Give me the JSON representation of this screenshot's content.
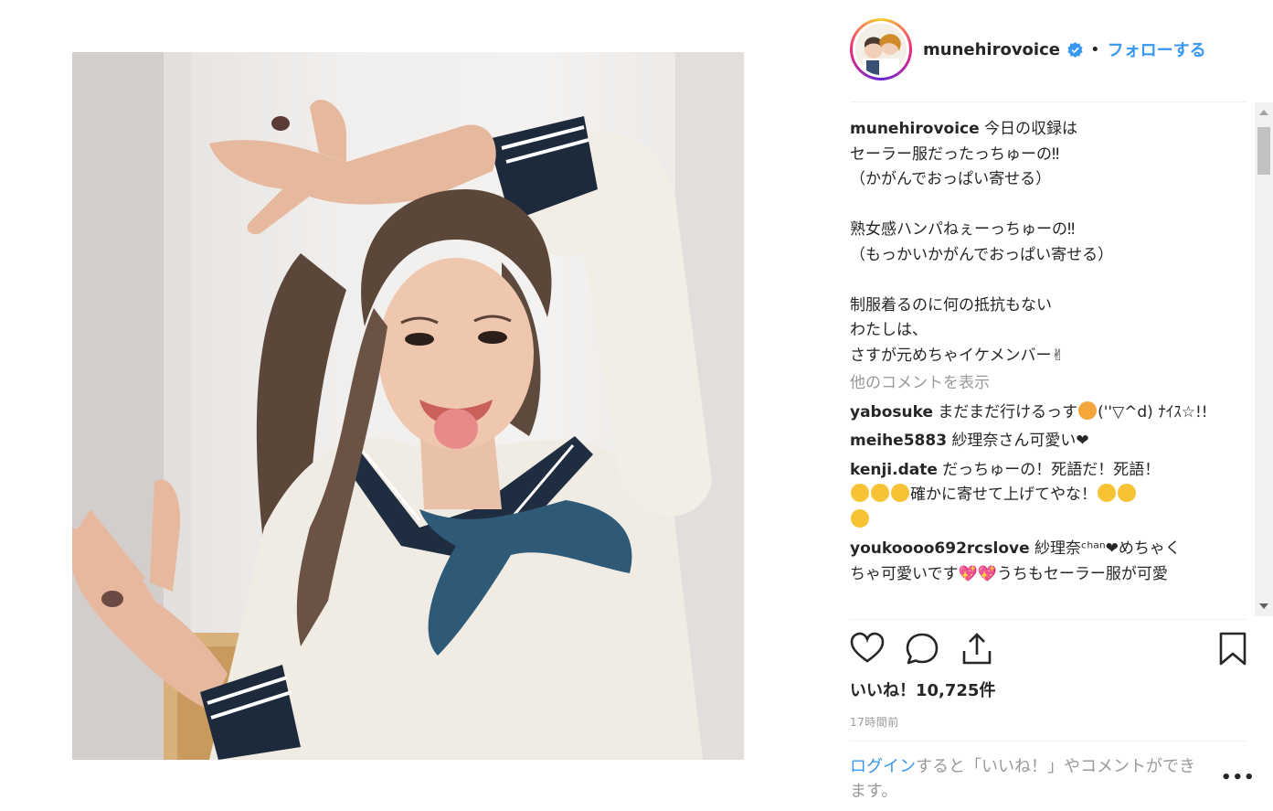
{
  "post": {
    "username": "munehirovoice",
    "dot": "•",
    "follow_label": "フォローする"
  },
  "caption": {
    "username": "munehirovoice",
    "lines": [
      "今日の収録は",
      "セーラー服だったっちゅーの‼",
      "（かがんでおっぱい寄せる）",
      "",
      "熟女感ハンパねぇーっちゅーの‼",
      "（もっかいかがんでおっぱい寄せる）",
      "",
      "制服着るのに何の抵抗もない",
      "わたしは、",
      "さすが元めちゃイケメンバー✌"
    ]
  },
  "more_comments": "他のコメントを表示",
  "comments": [
    {
      "user": "yabosuke",
      "text_a": "まだまだ行けるっす",
      "text_b": "(''▽^d) ﾅｲｽ☆!!"
    },
    {
      "user": "meihe5883",
      "text": "紗理奈さん可愛い❤"
    },
    {
      "user": "kenji.date",
      "text_a": "だっちゅーの！死語だ！死語！",
      "text_b": "確かに寄せて上げてやな！"
    },
    {
      "user": "youkoooo692rcslove",
      "text_a": "紗理奈ᶜʰᵃⁿ❤めちゃく",
      "text_b": "ちゃ可愛いです💖💖うちもセーラー服が可愛"
    }
  ],
  "likes": "いいね！10,725件",
  "time": "17時間前",
  "login": {
    "link": "ログイン",
    "text": "すると「いいね！」やコメントができます。"
  },
  "ellipsis": "•••",
  "icons": [
    "heart-icon",
    "comment-icon",
    "share-icon",
    "bookmark-icon",
    "verified-badge-icon"
  ],
  "colors": {
    "accent": "#3897f0",
    "text": "#262626",
    "muted": "#999999"
  }
}
